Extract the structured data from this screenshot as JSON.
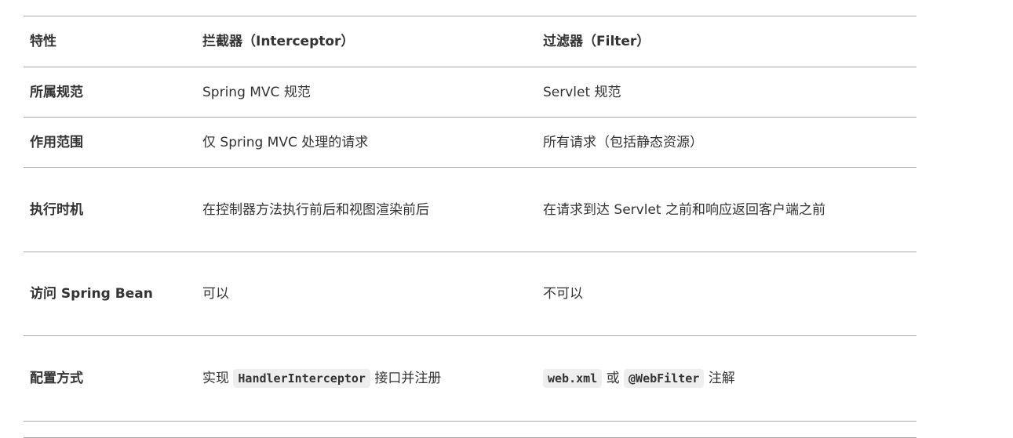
{
  "headers": [
    "特性",
    "拦截器（Interceptor）",
    "过滤器（Filter）"
  ],
  "rows": [
    {
      "feature": "所属规范",
      "interceptor": "Spring MVC 规范",
      "filter": "Servlet 规范"
    },
    {
      "feature": "作用范围",
      "interceptor": "仅 Spring MVC 处理的请求",
      "filter": "所有请求（包括静态资源）"
    },
    {
      "feature": "执行时机",
      "interceptor": "在控制器方法执行前后和视图渲染前后",
      "filter": "在请求到达 Servlet 之前和响应返回客户端之前"
    },
    {
      "feature": "访问 Spring Bean",
      "interceptor": "可以",
      "filter": "不可以"
    },
    {
      "feature": "配置方式",
      "interceptor_parts": {
        "pre": "实现 ",
        "code": "HandlerInterceptor",
        "post": " 接口并注册"
      },
      "filter_parts": {
        "code1": "web.xml",
        "mid": " 或 ",
        "code2": "@WebFilter",
        "post": " 注解"
      }
    }
  ]
}
